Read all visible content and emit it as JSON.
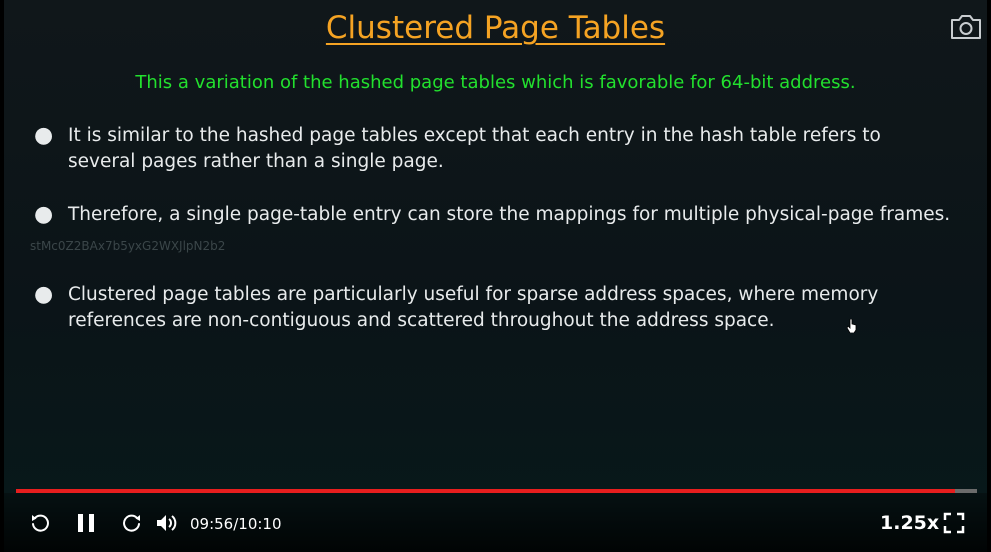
{
  "slide": {
    "title": "Clustered Page Tables",
    "subtitle": "This a variation of the hashed page tables which is favorable for 64-bit address.",
    "bullets": [
      "It is similar to the hashed page tables except that each entry in the hash table refers to several pages rather than a single page.",
      "Therefore, a single page-table entry can store the mappings for multiple physical-page frames.",
      "Clustered page tables are particularly useful for sparse address spaces, where memory references are non-contiguous and scattered throughout the address space."
    ],
    "bullet_symbol": "●",
    "watermark": "stMc0Z2BAx7b5yxG2WXJlpN2b2"
  },
  "player": {
    "current_time": "09:56",
    "duration": "10:10",
    "time_display": "09:56/10:10",
    "progress_fraction": 0.977,
    "speed": "1.25x",
    "icons": {
      "rewind": "rewind-icon",
      "pause": "pause-icon",
      "forward": "forward-icon",
      "volume": "volume-icon",
      "fullscreen": "fullscreen-icon",
      "camera": "camera-icon"
    }
  },
  "colors": {
    "title": "#f5a323",
    "subtitle": "#22e02e",
    "body_text": "#e8ebec",
    "progress": "#e61e1e"
  }
}
